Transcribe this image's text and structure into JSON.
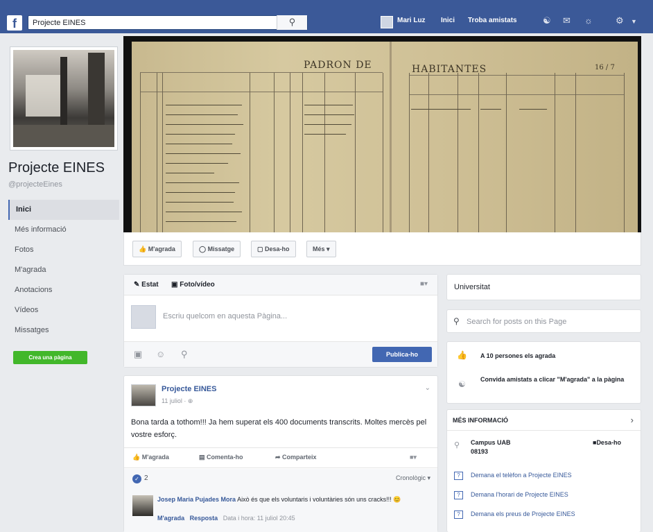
{
  "topbar": {
    "logo": "f",
    "search_value": "Projecte EINES",
    "search_icon": "magnifier-icon",
    "user_name": "Mari Luz",
    "nav_home": "Inici",
    "nav_friends": "Troba amistats",
    "icons": [
      "friend-requests-icon",
      "messages-icon",
      "notifications-icon",
      "settings-icon"
    ]
  },
  "sidebar": {
    "page_name": "Projecte EINES",
    "page_handle": "@projecteEines",
    "items": [
      {
        "label": "Inici",
        "active": true
      },
      {
        "label": "Més informació",
        "active": false
      },
      {
        "label": "Fotos",
        "active": false
      },
      {
        "label": "M'agrada",
        "active": false
      },
      {
        "label": "Anotacions",
        "active": false
      },
      {
        "label": "Vídeos",
        "active": false
      },
      {
        "label": "Missatges",
        "active": false
      }
    ],
    "create_page_label": "Crea una pàgina"
  },
  "cover": {
    "title_left": "PADRON DE",
    "title_right": "HABITANTES",
    "page_number": "16 / 7"
  },
  "page_actions": {
    "like": "M'agrada",
    "message": "Missatge",
    "save": "Desa-ho",
    "more": "Més ▾"
  },
  "composer": {
    "tab_status": "Estat",
    "tab_photo": "Foto/vídeo",
    "placeholder": "Escriu quelcom en aquesta Pàgina...",
    "publish": "Publica-ho"
  },
  "post": {
    "author": "Projecte EINES",
    "date": "11 juliol · ⊕",
    "text": "Bona tarda a tothom!!! Ja hem superat els 400 documents transcrits. Moltes mercès pel vostre esforç.",
    "actions": {
      "like": "M'agrada",
      "comment": "Comenta-ho",
      "share": "Comparteix"
    },
    "like_count": "2",
    "sort": "Cronològic ▾",
    "comment": {
      "author": "Josep Maria Pujades Mora",
      "text": "Això és que els voluntaris i voluntàries són uns cracks!!! 😊",
      "like": "M'agrada",
      "reply": "Resposta",
      "timestamp": "Data i hora: 11 juliol 20:45"
    }
  },
  "right": {
    "category": "Universitat",
    "search_placeholder": "Search for posts on this Page",
    "likes_text": "A 10 persones els agrada",
    "invite_text": "Convida amistats a clicar \"M'agrada\" a la pàgina",
    "info_header": "MÉS INFORMACIÓ",
    "address_line1": "Campus UAB",
    "address_line2": "08193",
    "save_label": "Desa-ho",
    "links": [
      "Demana el telèfon a Projecte EINES",
      "Demana l'horari de Projecte EINES",
      "Demana els preus de Projecte EINES"
    ]
  }
}
